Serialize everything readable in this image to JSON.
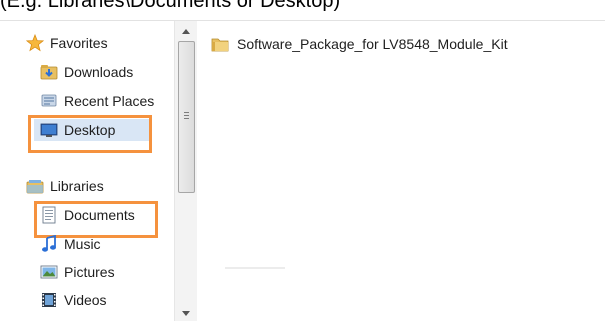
{
  "caption": {
    "text": "(E.g. Libraries\\Documents or Desktop)"
  },
  "nav": {
    "favorites": {
      "label": "Favorites",
      "icon": "star-icon"
    },
    "favorites_items": [
      {
        "label": "Downloads",
        "icon": "downloads-folder-icon"
      },
      {
        "label": "Recent Places",
        "icon": "recent-places-icon"
      },
      {
        "label": "Desktop",
        "icon": "desktop-icon",
        "selected": true,
        "highlighted": true
      }
    ],
    "libraries": {
      "label": "Libraries",
      "icon": "libraries-icon"
    },
    "libraries_items": [
      {
        "label": "Documents",
        "icon": "documents-icon",
        "highlighted": true
      },
      {
        "label": "Music",
        "icon": "music-icon"
      },
      {
        "label": "Pictures",
        "icon": "pictures-icon"
      },
      {
        "label": "Videos",
        "icon": "videos-icon"
      }
    ]
  },
  "content": {
    "items": [
      {
        "label": "Software_Package_for LV8548_Module_Kit",
        "icon": "folder-icon"
      }
    ]
  },
  "colors": {
    "highlight": "#f5923e",
    "selection": "#d9e6f5",
    "folder": "#e8c062"
  }
}
